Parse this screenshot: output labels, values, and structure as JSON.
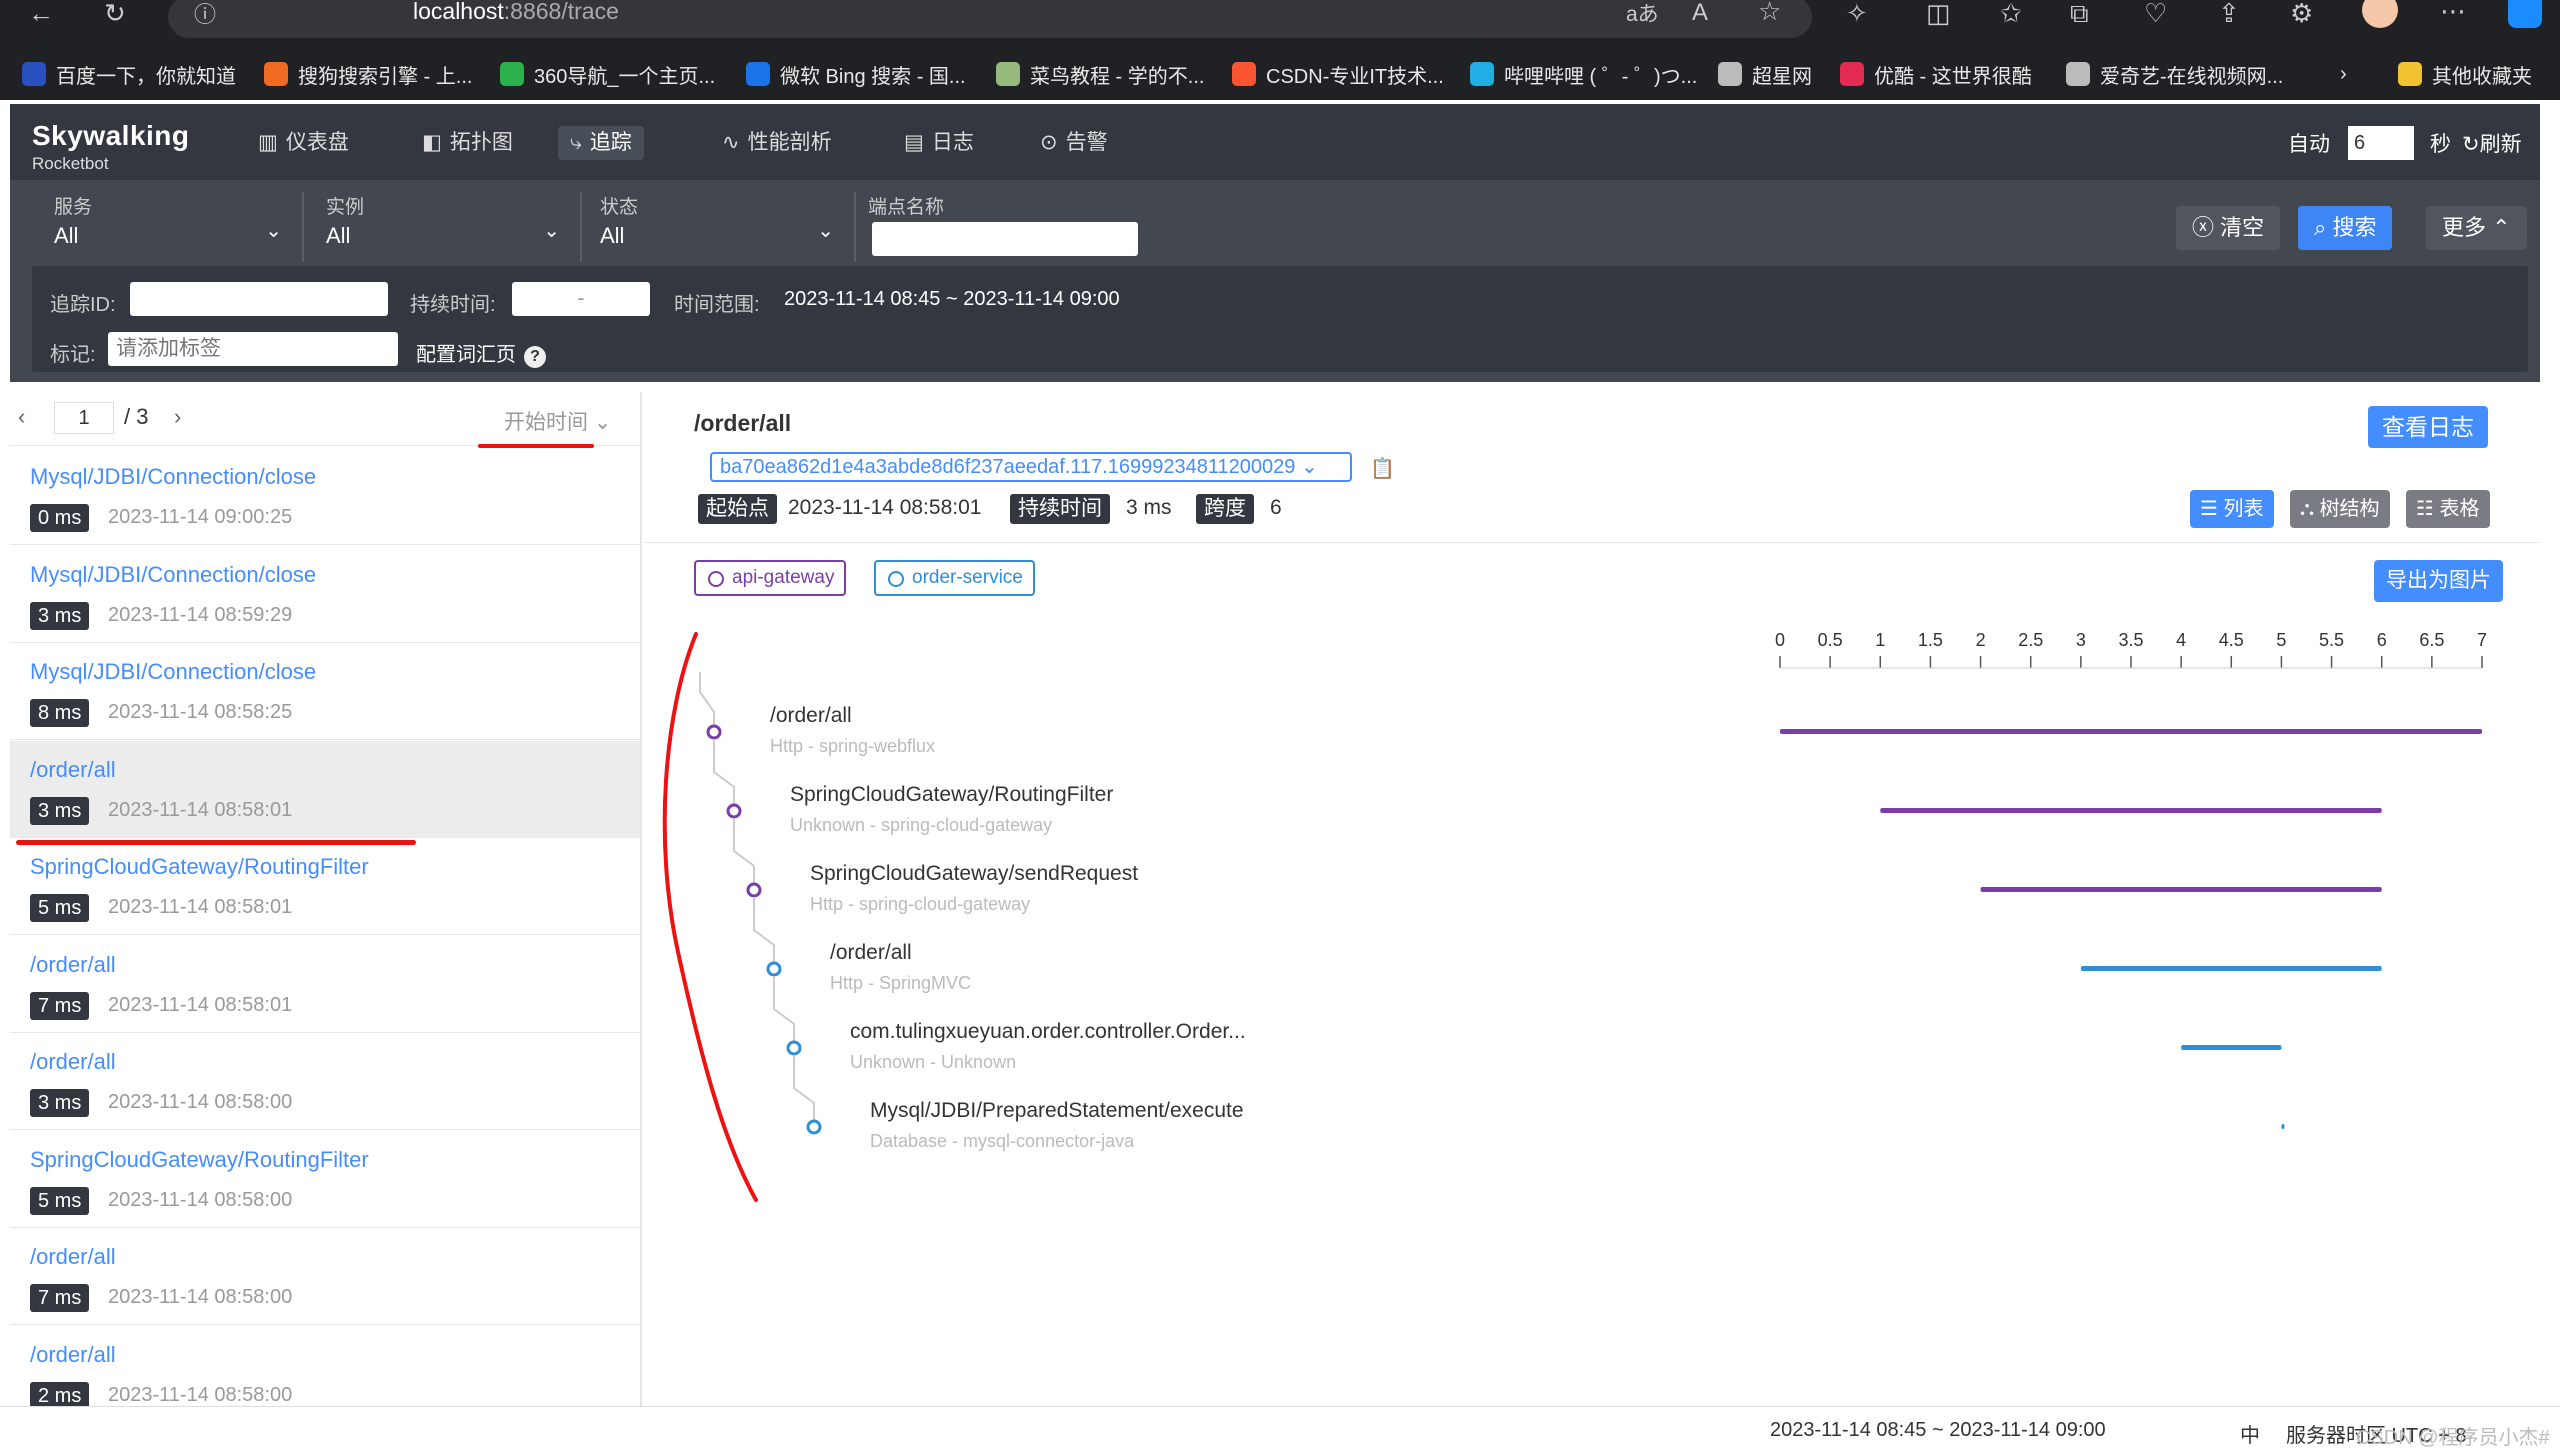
{
  "browser": {
    "url_host": "localhost",
    "url_port": ":8868",
    "url_path": "/trace",
    "bookmarks": [
      {
        "label": "百度一下，你就知道",
        "color": "#2a52be"
      },
      {
        "label": "搜狗搜索引擎 - 上...",
        "color": "#f26b22"
      },
      {
        "label": "360导航_一个主页...",
        "color": "#2bb24c"
      },
      {
        "label": "微软 Bing 搜索 - 国...",
        "color": "#1a73e8"
      },
      {
        "label": "菜鸟教程 - 学的不...",
        "color": "#96b97d"
      },
      {
        "label": "CSDN-专业IT技术...",
        "color": "#fc5531"
      },
      {
        "label": "哔哩哔哩 ( ゜- ゜)つ...",
        "color": "#23ade5"
      },
      {
        "label": "超星网",
        "color": "#bbbbbb"
      },
      {
        "label": "优酷 - 这世界很酷",
        "color": "#e42a51"
      },
      {
        "label": "爱奇艺-在线视频网...",
        "color": "#bbbbbb"
      },
      {
        "label": "其他收藏夹",
        "color": "#f1c232"
      }
    ]
  },
  "app": {
    "logo_title": "Skywalking",
    "logo_sub": "Rocketbot",
    "nav": [
      "仪表盘",
      "拓扑图",
      "追踪",
      "性能剖析",
      "日志",
      "告警"
    ],
    "auto_label": "自动",
    "auto_value": "6",
    "seconds_label": "秒",
    "refresh_label": "刷新"
  },
  "filters": {
    "service_label": "服务",
    "service_value": "All",
    "instance_label": "实例",
    "instance_value": "All",
    "status_label": "状态",
    "status_value": "All",
    "endpoint_label": "端点名称",
    "clear_label": "清空",
    "search_label": "搜索",
    "more_label": "更多",
    "traceid_label": "追踪ID:",
    "duration_label": "持续时间:",
    "duration_sep": "-",
    "timerange_label": "时间范围:",
    "timerange_value": "2023-11-14 08:45 ~ 2023-11-14 09:00",
    "tags_label": "标记:",
    "tags_placeholder": "请添加标签",
    "vocab_label": "配置词汇页"
  },
  "list": {
    "page": "1",
    "total": "/ 3",
    "sort_label": "开始时间",
    "items": [
      {
        "name": "Mysql/JDBI/Connection/close",
        "dur": "0 ms",
        "time": "2023-11-14 09:00:25"
      },
      {
        "name": "Mysql/JDBI/Connection/close",
        "dur": "3 ms",
        "time": "2023-11-14 08:59:29"
      },
      {
        "name": "Mysql/JDBI/Connection/close",
        "dur": "8 ms",
        "time": "2023-11-14 08:58:25"
      },
      {
        "name": "/order/all",
        "dur": "3 ms",
        "time": "2023-11-14 08:58:01"
      },
      {
        "name": "SpringCloudGateway/RoutingFilter",
        "dur": "5 ms",
        "time": "2023-11-14 08:58:01"
      },
      {
        "name": "/order/all",
        "dur": "7 ms",
        "time": "2023-11-14 08:58:01"
      },
      {
        "name": "/order/all",
        "dur": "3 ms",
        "time": "2023-11-14 08:58:00"
      },
      {
        "name": "SpringCloudGateway/RoutingFilter",
        "dur": "5 ms",
        "time": "2023-11-14 08:58:00"
      },
      {
        "name": "/order/all",
        "dur": "7 ms",
        "time": "2023-11-14 08:58:00"
      },
      {
        "name": "/order/all",
        "dur": "2 ms",
        "time": "2023-11-14 08:58:00"
      }
    ]
  },
  "detail": {
    "title": "/order/all",
    "trace_id": "ba70ea862d1e4a3abde8d6f237aeedaf.117.16999234811200029",
    "start_label": "起始点",
    "start_value": "2023-11-14 08:58:01",
    "duration_label": "持续时间",
    "duration_value": "3 ms",
    "span_label": "跨度",
    "span_value": "6",
    "view_logs": "查看日志",
    "view_list": "列表",
    "view_tree": "树结构",
    "view_table": "表格",
    "export_label": "导出为图片",
    "services": [
      {
        "name": "api-gateway",
        "color": "#7b3ea8"
      },
      {
        "name": "order-service",
        "color": "#2e8fd6"
      }
    ],
    "axis_ticks": [
      "0",
      "0.5",
      "1",
      "1.5",
      "2",
      "2.5",
      "3",
      "3.5",
      "4",
      "4.5",
      "5",
      "5.5",
      "6",
      "6.5",
      "7"
    ],
    "spans": [
      {
        "name": "/order/all",
        "sub": "Http - spring-webflux",
        "start": 0,
        "end": 7,
        "service": 0
      },
      {
        "name": "SpringCloudGateway/RoutingFilter",
        "sub": "Unknown - spring-cloud-gateway",
        "start": 1,
        "end": 6,
        "service": 0
      },
      {
        "name": "SpringCloudGateway/sendRequest",
        "sub": "Http - spring-cloud-gateway",
        "start": 2,
        "end": 6,
        "service": 0
      },
      {
        "name": "/order/all",
        "sub": "Http - SpringMVC",
        "start": 3,
        "end": 6,
        "service": 1
      },
      {
        "name": "com.tulingxueyuan.order.controller.Order...",
        "sub": "Unknown - Unknown",
        "start": 4,
        "end": 5,
        "service": 1
      },
      {
        "name": "Mysql/JDBI/PreparedStatement/execute",
        "sub": "Database - mysql-connector-java",
        "start": 5,
        "end": 5,
        "service": 1
      }
    ]
  },
  "footer": {
    "time": "2023-11-14 08:45 ~ 2023-11-14 09:00",
    "lang": "中",
    "tz": "服务器时区 UTC + 8",
    "watermark": "CSDN @程序员小杰#"
  }
}
